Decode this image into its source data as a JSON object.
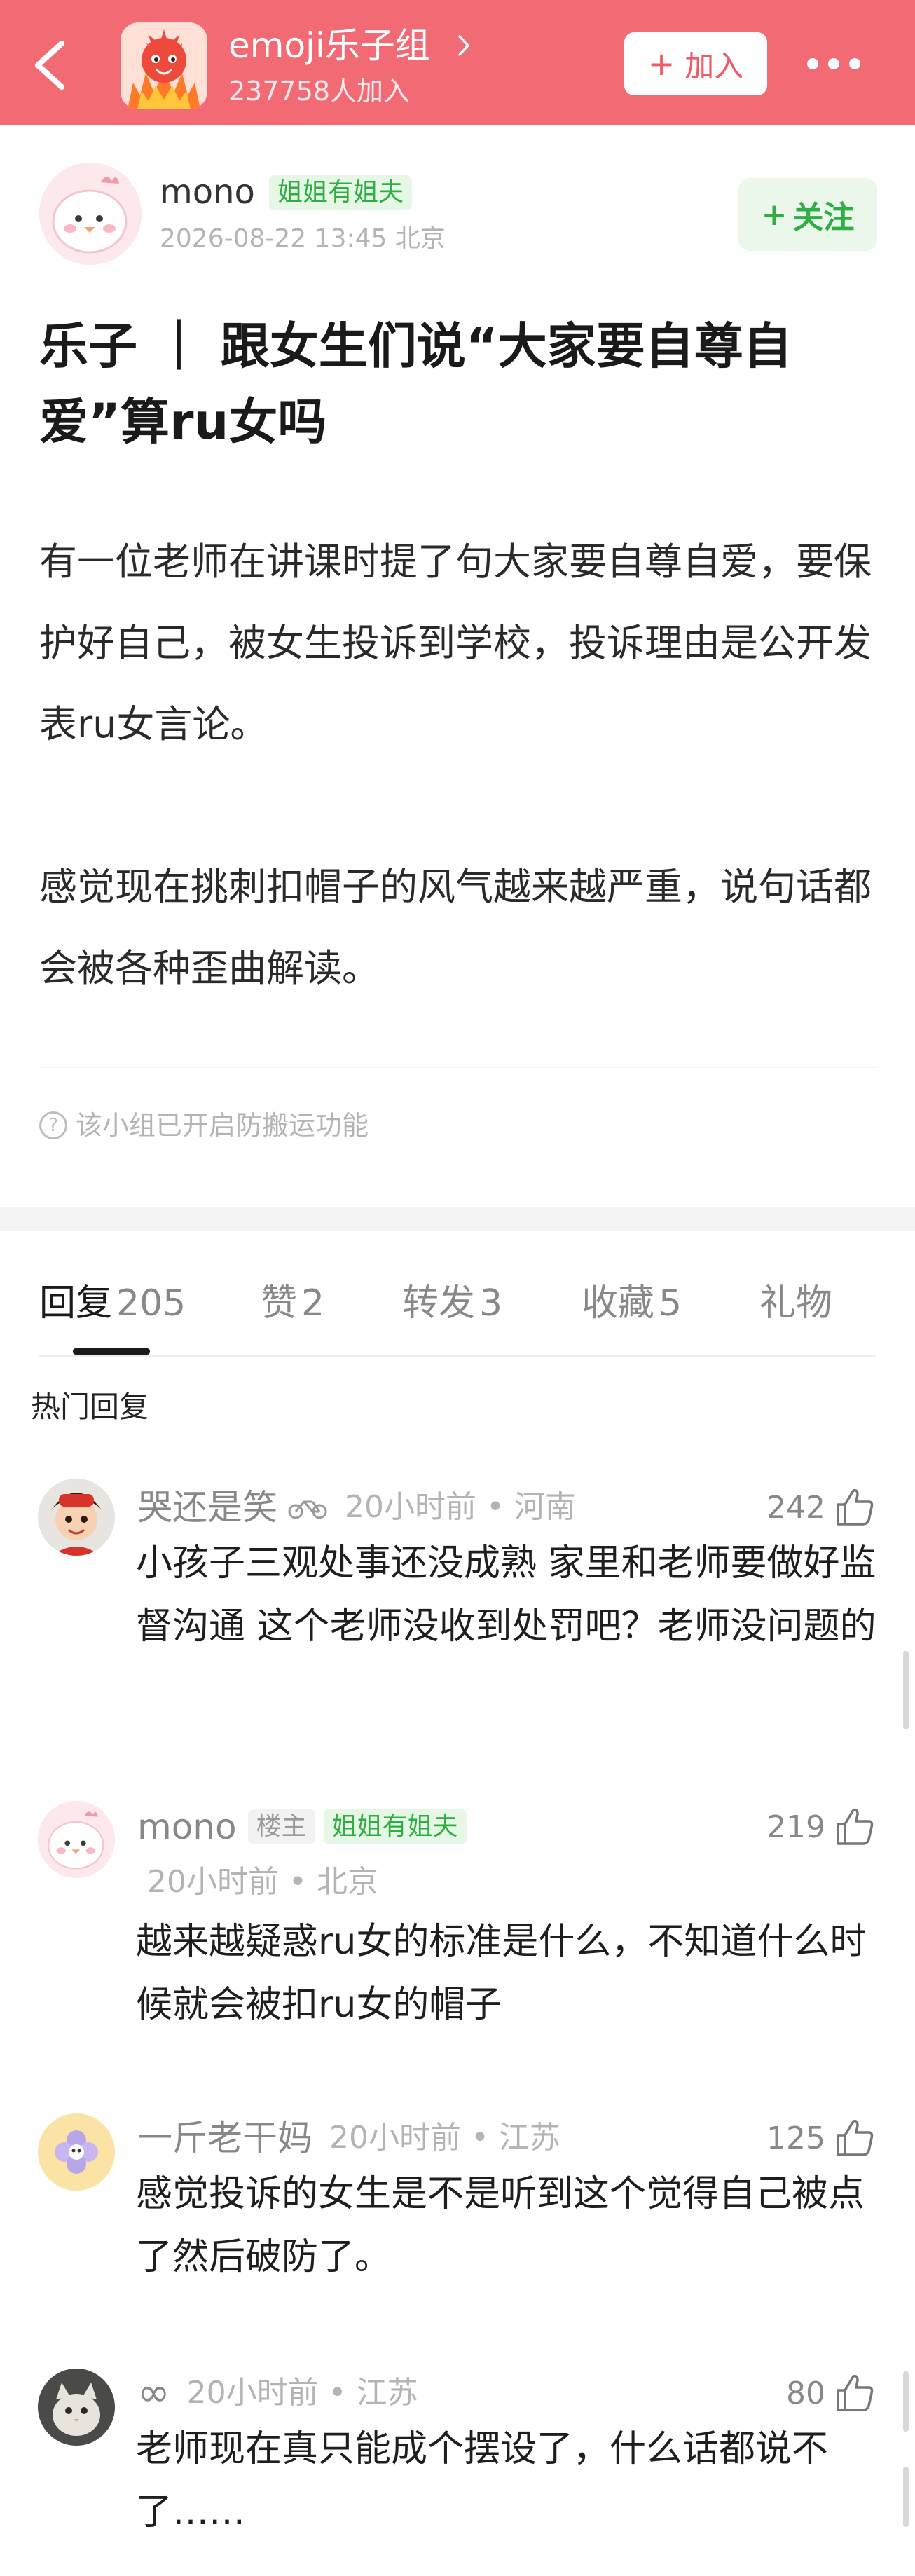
{
  "header": {
    "group_name": "emoji乐子组",
    "members": "237758人加入",
    "join_label": "加入",
    "colors": {
      "bar": "#f26a74",
      "join_text": "#f05a66"
    }
  },
  "post": {
    "author": {
      "name": "mono",
      "badge": "姐姐有姐夫"
    },
    "meta": "2026-08-22 13:45  北京",
    "follow_label": "关注",
    "title": "乐子 ｜ 跟女生们说“大家要自尊自爱”算ru女吗",
    "body": [
      "有一位老师在讲课时提了句大家要自尊自爱，要保护好自己，被女生投诉到学校，投诉理由是公开发表ru女言论。",
      "感觉现在挑刺扣帽子的风气越来越严重，说句话都会被各种歪曲解读。"
    ],
    "notice": "该小组已开启防搬运功能"
  },
  "tabs": [
    {
      "label": "回复",
      "count": "205",
      "active": true
    },
    {
      "label": "赞",
      "count": "2",
      "active": false
    },
    {
      "label": "转发",
      "count": "3",
      "active": false
    },
    {
      "label": "收藏",
      "count": "5",
      "active": false
    },
    {
      "label": "礼物",
      "count": "",
      "active": false
    }
  ],
  "hot_label": "热门回复",
  "comments": [
    {
      "name": "哭还是笑",
      "icon": "bicycle-icon",
      "time": "20小时前 • 河南",
      "likes": "242",
      "text": "小孩子三观处事还没成熟 家里和老师要做好监督沟通 这个老师没收到处罚吧？老师没问题的"
    },
    {
      "name": "mono",
      "owner_tag": "楼主",
      "badge": "姐姐有姐夫",
      "time": "20小时前 • 北京",
      "likes": "219",
      "text": "越来越疑惑ru女的标准是什么，不知道什么时候就会被扣ru女的帽子"
    },
    {
      "name": "一斤老干妈",
      "time": "20小时前 • 江苏",
      "likes": "125",
      "text": "感觉投诉的女生是不是听到这个觉得自己被点了然后破防了。"
    },
    {
      "name": "∞",
      "time": "20小时前 • 江苏",
      "likes": "80",
      "text": "老师现在真只能成个摆设了，什么话都说不了……"
    }
  ]
}
